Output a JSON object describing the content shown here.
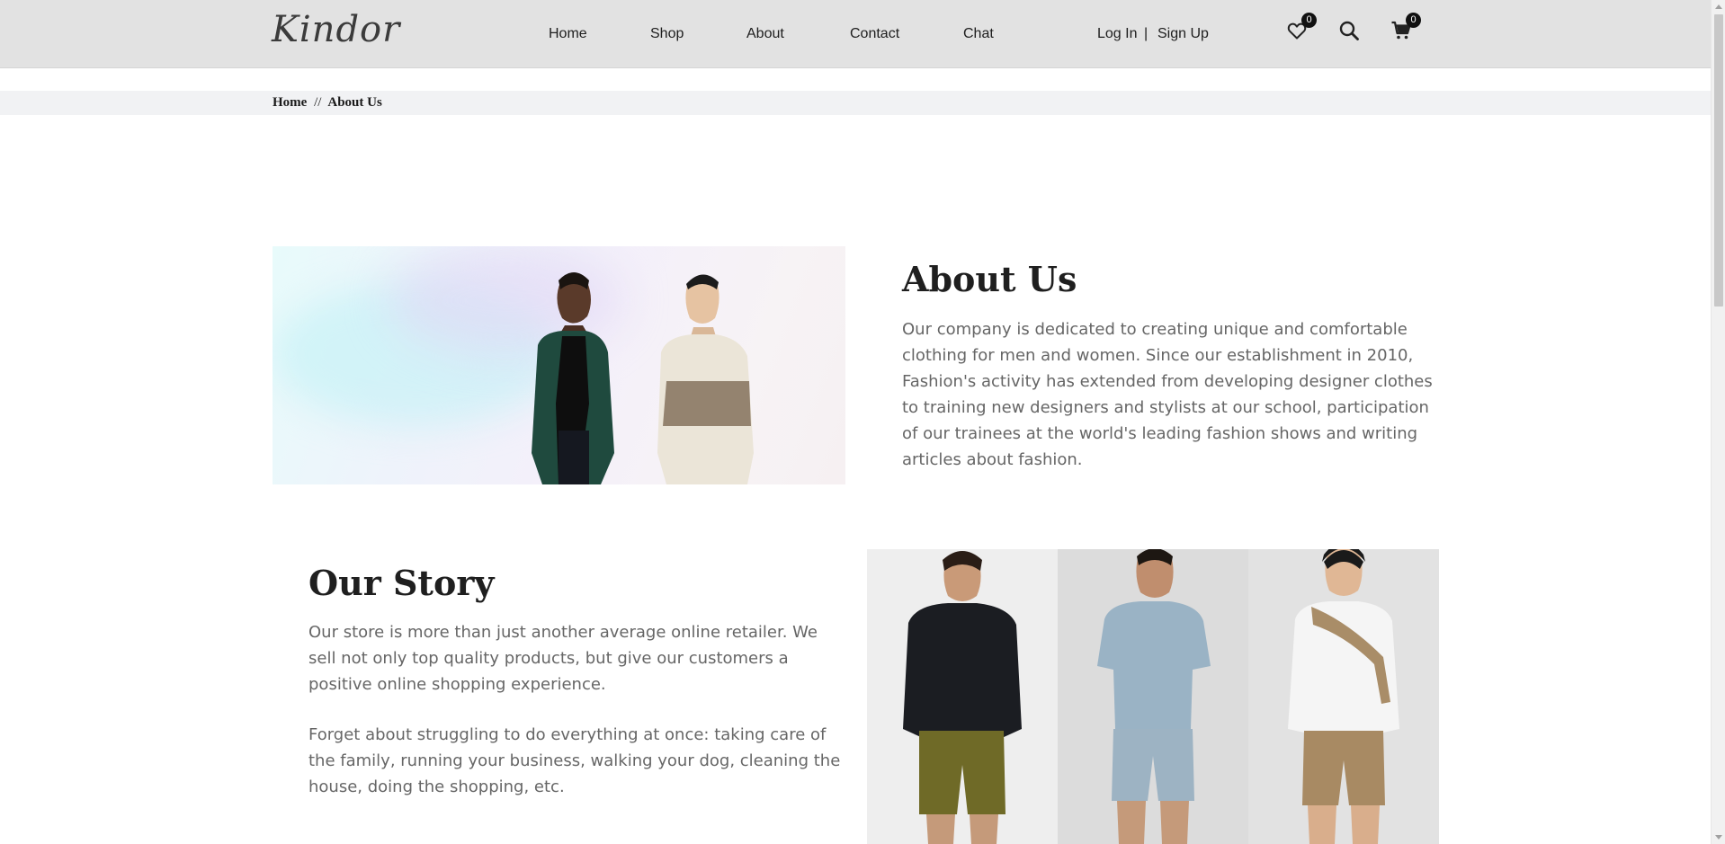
{
  "header": {
    "logo": "Kindor",
    "nav": [
      "Home",
      "Shop",
      "About",
      "Contact",
      "Chat"
    ],
    "auth": {
      "login": "Log In",
      "separator": "|",
      "signup": "Sign Up"
    },
    "wishlist_count": "0",
    "cart_count": "0",
    "icons": [
      "heart-icon",
      "search-icon",
      "cart-icon"
    ]
  },
  "breadcrumb": {
    "home": "Home",
    "separator": "//",
    "current": "About Us"
  },
  "about": {
    "title": "About Us",
    "text": "Our company is dedicated to creating unique and comfortable clothing for men and women. Since our establishment in 2010, Fashion's activity has extended from developing designer clothes to training new designers and stylists at our school, participation of our trainees at the world's leading fashion shows and writing articles about fashion."
  },
  "story": {
    "title": "Our Story",
    "paragraph1": "Our store is more than just another average online retailer. We sell not only top quality products, but give our customers a positive online shopping experience.",
    "paragraph2": "Forget about struggling to do everything at once: taking care of the family, running your business, walking your dog, cleaning the house, doing the shopping, etc."
  },
  "colors": {
    "header_bg": "#e2e2e2",
    "text_muted": "#666666",
    "badge": "#111111"
  }
}
